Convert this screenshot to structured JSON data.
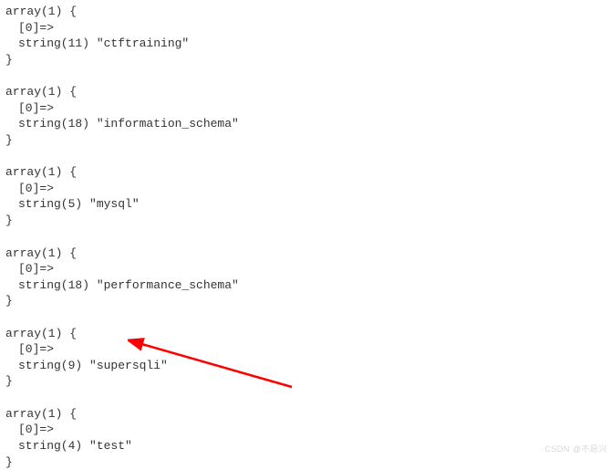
{
  "blocks": [
    {
      "header": "array(1) {",
      "index": "[0]=>",
      "value": "string(11) \"ctftraining\"",
      "close": "}"
    },
    {
      "header": "array(1) {",
      "index": "[0]=>",
      "value": "string(18) \"information_schema\"",
      "close": "}"
    },
    {
      "header": "array(1) {",
      "index": "[0]=>",
      "value": "string(5) \"mysql\"",
      "close": "}"
    },
    {
      "header": "array(1) {",
      "index": "[0]=>",
      "value": "string(18) \"performance_schema\"",
      "close": "}"
    },
    {
      "header": "array(1) {",
      "index": "[0]=>",
      "value": "string(9) \"supersqli\"",
      "close": "}"
    },
    {
      "header": "array(1) {",
      "index": "[0]=>",
      "value": "string(4) \"test\"",
      "close": "}"
    }
  ],
  "watermark": "CSDN @不愿兴"
}
